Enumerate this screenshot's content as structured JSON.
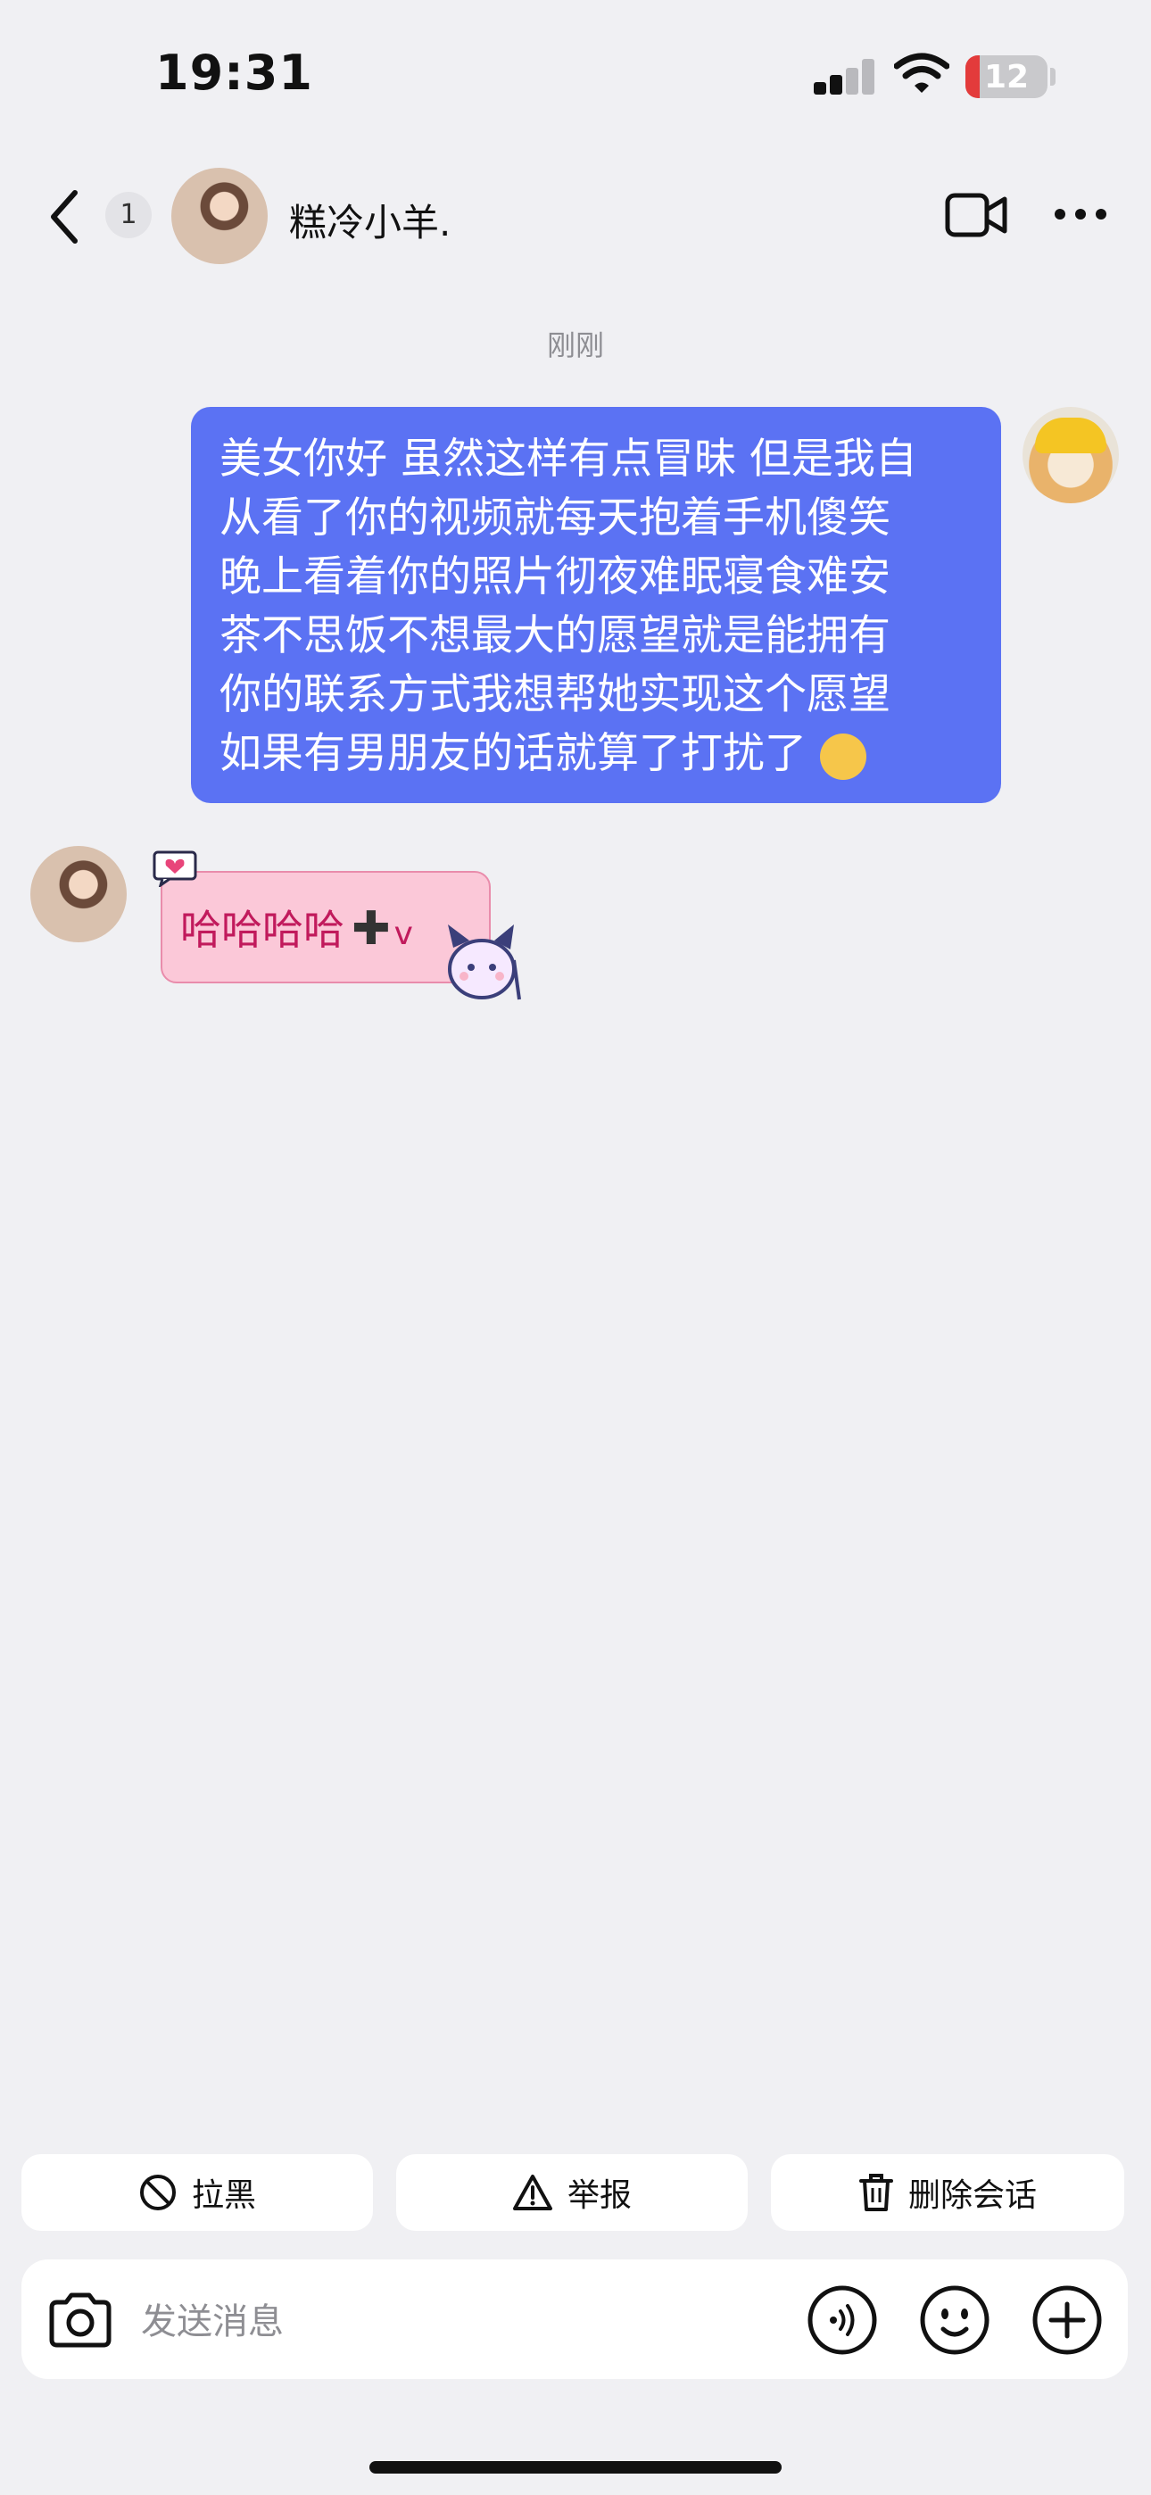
{
  "status_bar": {
    "time": "19:31",
    "battery": "12"
  },
  "header": {
    "unread_count": "1",
    "contact_name": "糕冷小羊."
  },
  "chat": {
    "timestamp": "刚刚",
    "sent_message": {
      "lines": [
        "美女你好 虽然这样有点冒昧 但是我自",
        "从看了你的视频就每天抱着手机傻笑",
        "晚上看着你的照片彻夜难眠寝食难安",
        "茶不思饭不想最大的愿望就是能拥有",
        "你的联系方式我想帮她实现这个愿望",
        "如果有男朋友的话就算了打扰了"
      ]
    },
    "received_message": {
      "text": "哈哈哈哈",
      "plus": "✚",
      "suffix": "v"
    }
  },
  "actions": {
    "block": "拉黑",
    "report": "举报",
    "delete": "删除会话"
  },
  "composer": {
    "placeholder": "发送消息"
  },
  "colors": {
    "sent_bubble": "#5b72f3",
    "received_bubble": "#fbc8d8",
    "received_text": "#c11a5c"
  }
}
